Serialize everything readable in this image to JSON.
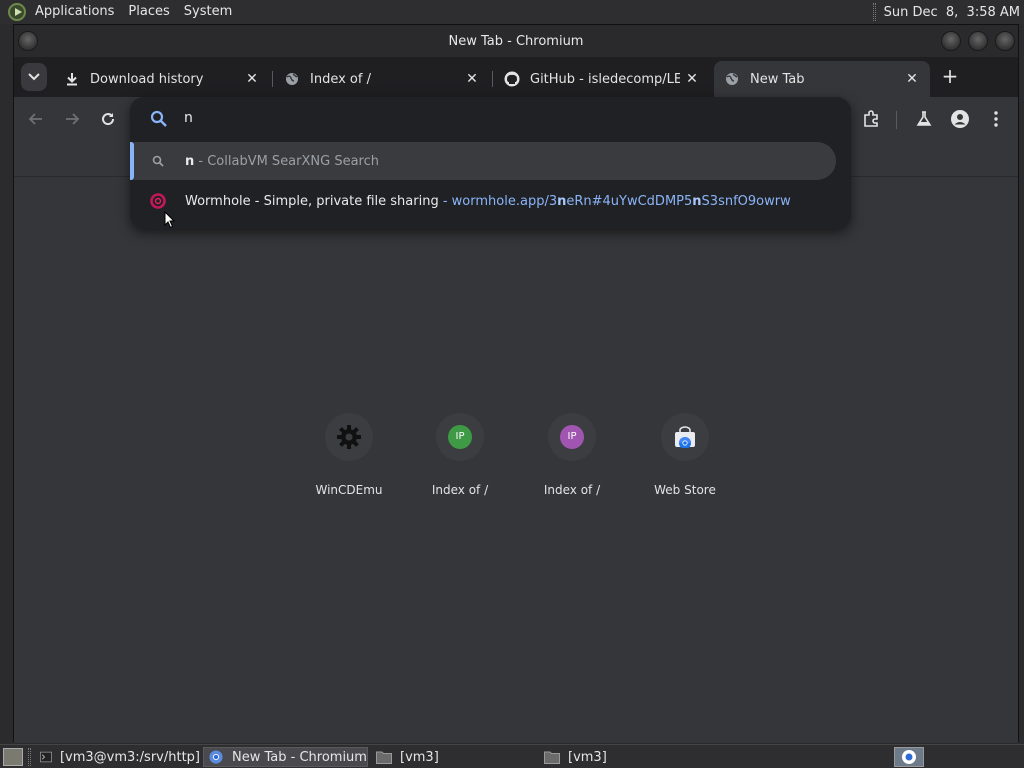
{
  "panel": {
    "applications": "Applications",
    "places": "Places",
    "system": "System",
    "clock": "Sun Dec  8,  3:58 AM"
  },
  "window": {
    "title": "New Tab - Chromium"
  },
  "tabs": [
    {
      "title": "Download history",
      "icon": "download-icon"
    },
    {
      "title": "Index of /",
      "icon": "globe-icon"
    },
    {
      "title": "GitHub - isledecomp/LEG",
      "icon": "github-icon"
    },
    {
      "title": "New Tab",
      "icon": "globe-icon",
      "active": true
    }
  ],
  "omnibox": {
    "input": "n",
    "suggestions": [
      {
        "match": "n",
        "rest": " - CollabVM SearXNG Search",
        "icon": "search-icon"
      },
      {
        "title": "Wormhole - Simple, private file sharing",
        "sep": " - ",
        "url_pre": "wormhole.app/3",
        "url_b1": "n",
        "url_mid": "eRn#4uYwCdDMP5",
        "url_b2": "n",
        "url_post": "S3snfO9owrw",
        "icon": "wormhole-icon"
      }
    ]
  },
  "shortcuts": [
    {
      "title": "WinCDEmu",
      "icon": "gear-icon"
    },
    {
      "title": "Index of /",
      "badge": "IP",
      "color": "#3f9a45"
    },
    {
      "title": "Index of /",
      "badge": "IP",
      "color": "#a056b0"
    },
    {
      "title": "Web Store",
      "icon": "web-store-icon"
    }
  ],
  "taskbar": {
    "items": [
      {
        "label": "[vm3@vm3:/srv/http]",
        "icon": "terminal-icon"
      },
      {
        "label": "New Tab - Chromium",
        "icon": "chromium-icon",
        "active": true
      },
      {
        "label": "[vm3]",
        "icon": "folder-icon"
      },
      {
        "label": "[vm3]",
        "icon": "folder-icon"
      }
    ]
  },
  "colors": {
    "accent": "#8ab4f8",
    "ntp_bg": "#35363a",
    "omnibox_bg": "#202124"
  }
}
